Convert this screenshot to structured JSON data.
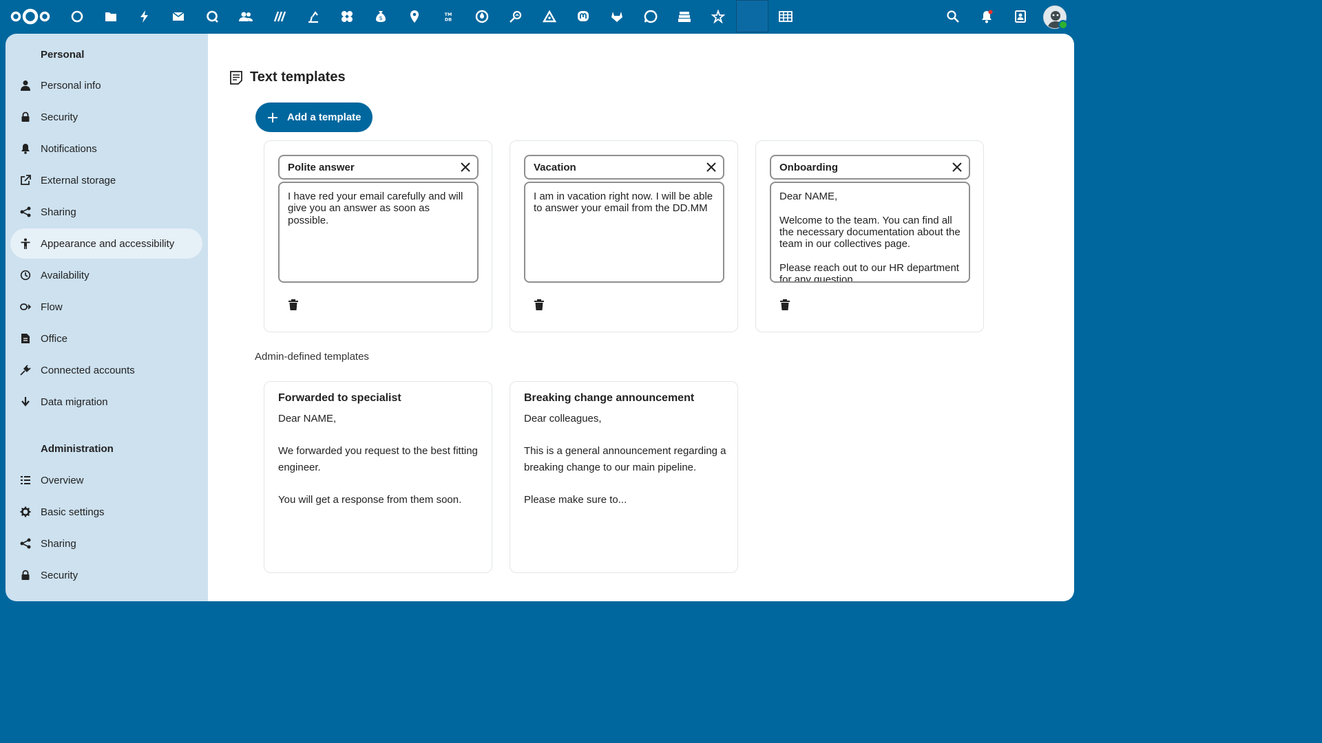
{
  "topbar": {
    "apps": [
      {
        "name": "dashboard-app-icon"
      },
      {
        "name": "files-app-icon"
      },
      {
        "name": "activity-app-icon"
      },
      {
        "name": "mail-app-icon"
      },
      {
        "name": "talk-app-icon"
      },
      {
        "name": "contacts-app-icon"
      },
      {
        "name": "deck-app-icon"
      },
      {
        "name": "cospend-app-icon"
      },
      {
        "name": "collectives-app-icon"
      },
      {
        "name": "cospend-money-app-icon"
      },
      {
        "name": "maps-app-icon"
      },
      {
        "name": "tmdb-app-icon"
      },
      {
        "name": "drop-app-icon"
      },
      {
        "name": "analytics-app-icon"
      },
      {
        "name": "delta-app-icon"
      },
      {
        "name": "mastodon-app-icon"
      },
      {
        "name": "gitlab-app-icon"
      },
      {
        "name": "discourse-app-icon"
      },
      {
        "name": "stack-app-icon"
      },
      {
        "name": "star-app-icon"
      }
    ],
    "tables_label": "tables"
  },
  "sidebar": {
    "personal_title": "Personal",
    "personal_items": [
      {
        "label": "Personal info",
        "icon": "user-icon"
      },
      {
        "label": "Security",
        "icon": "lock-icon"
      },
      {
        "label": "Notifications",
        "icon": "bell-icon"
      },
      {
        "label": "External storage",
        "icon": "external-icon"
      },
      {
        "label": "Sharing",
        "icon": "share-icon"
      },
      {
        "label": "Appearance and accessibility",
        "icon": "accessibility-icon"
      },
      {
        "label": "Availability",
        "icon": "clock-icon"
      },
      {
        "label": "Flow",
        "icon": "flow-icon"
      },
      {
        "label": "Office",
        "icon": "document-icon"
      },
      {
        "label": "Connected accounts",
        "icon": "plug-icon"
      },
      {
        "label": "Data migration",
        "icon": "download-icon"
      }
    ],
    "admin_title": "Administration",
    "admin_items": [
      {
        "label": "Overview",
        "icon": "list-icon"
      },
      {
        "label": "Basic settings",
        "icon": "gear-icon"
      },
      {
        "label": "Sharing",
        "icon": "share-icon"
      },
      {
        "label": "Security",
        "icon": "lock-icon"
      }
    ]
  },
  "main": {
    "title": "Text templates",
    "add_button": "Add a template",
    "templates": [
      {
        "title": "Polite answer",
        "body": "I have red your email carefully and will give you an answer as soon as possible."
      },
      {
        "title": "Vacation",
        "body": "I am in vacation right now. I will be able to answer your email from the DD.MM"
      },
      {
        "title": "Onboarding",
        "body": "Dear NAME,\n\nWelcome to the team. You can find all the necessary documentation about the team in our collectives page.\n\nPlease reach out to our HR department for any question."
      }
    ],
    "admin_label": "Admin-defined templates",
    "admin_templates": [
      {
        "title": "Forwarded to specialist",
        "body": "Dear NAME,\n\nWe forwarded you request to the best fitting engineer.\n\nYou will get a response from them soon."
      },
      {
        "title": "Breaking change announcement",
        "body": "Dear colleagues,\n\nThis is a general announcement regarding a breaking change to our main pipeline.\n\nPlease make sure to..."
      }
    ]
  },
  "colors": {
    "primary": "#00679e",
    "sidebar_bg": "#cde1ef",
    "active_item": "#e6f0f7"
  }
}
